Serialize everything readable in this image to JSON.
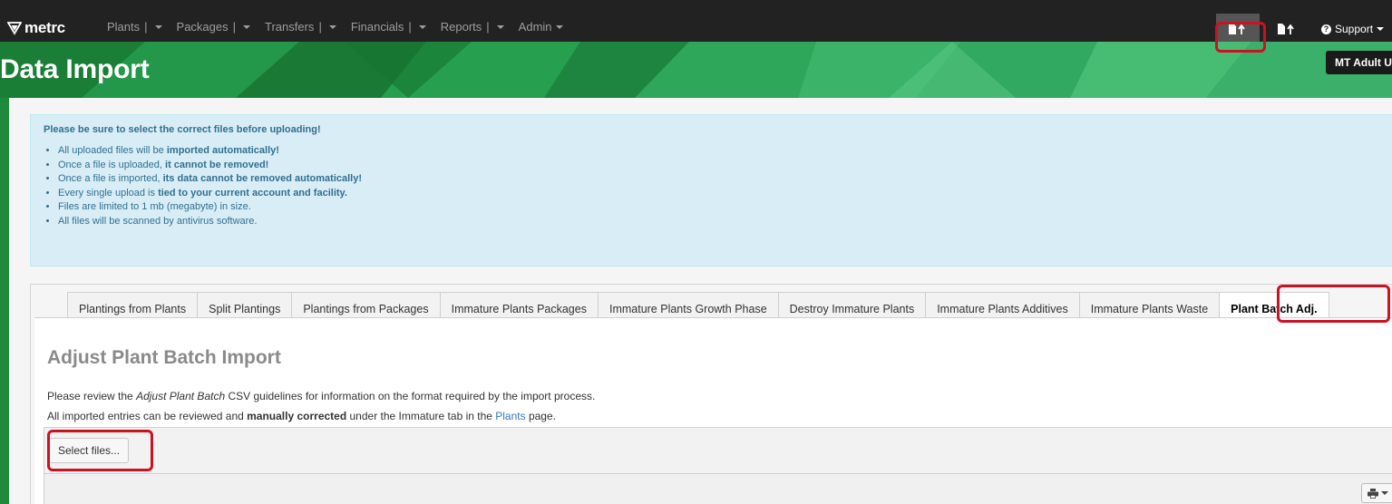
{
  "brand": {
    "name": "metrc"
  },
  "nav": {
    "items": [
      {
        "label": "Plants",
        "separator": "|"
      },
      {
        "label": "Packages",
        "separator": "|"
      },
      {
        "label": "Transfers",
        "separator": "|"
      },
      {
        "label": "Financials",
        "separator": "|"
      },
      {
        "label": "Reports",
        "separator": "|"
      },
      {
        "label": "Admin",
        "separator": ""
      }
    ],
    "support_label": "Support",
    "upload_icon": "file-upload-icon"
  },
  "header": {
    "title": "Data Import",
    "account_label": "MT Adult U"
  },
  "alert": {
    "lead": "Please be sure to select the correct files before uploading!",
    "items": [
      {
        "pre": "All uploaded files will be ",
        "bold": "imported automatically!",
        "post": ""
      },
      {
        "pre": "Once a file is uploaded, ",
        "bold": "it cannot be removed!",
        "post": ""
      },
      {
        "pre": "Once a file is imported, ",
        "bold": "its data cannot be removed automatically!",
        "post": ""
      },
      {
        "pre": "Every single upload is ",
        "bold": "tied to your current account and facility.",
        "post": ""
      },
      {
        "pre": "Files are limited to 1 mb (megabyte) in size.",
        "bold": "",
        "post": ""
      },
      {
        "pre": "All files will be scanned by antivirus software.",
        "bold": "",
        "post": ""
      }
    ]
  },
  "tabs": [
    {
      "label": "Plantings from Plants"
    },
    {
      "label": "Split Plantings"
    },
    {
      "label": "Plantings from Packages"
    },
    {
      "label": "Immature Plants Packages"
    },
    {
      "label": "Immature Plants Growth Phase"
    },
    {
      "label": "Destroy Immature Plants"
    },
    {
      "label": "Immature Plants Additives"
    },
    {
      "label": "Immature Plants Waste"
    },
    {
      "label": "Plant Batch Adj."
    }
  ],
  "active_tab": "Plant Batch Adj.",
  "section": {
    "title": "Adjust Plant Batch Import",
    "line1_pre": "Please review the ",
    "line1_italic": "Adjust Plant Batch",
    "line1_post": " CSV guidelines for information on the format required by the import process.",
    "line2_pre": "All imported entries can be reviewed and ",
    "line2_bold": "manually corrected",
    "line2_mid": " under the Immature tab in the ",
    "line2_link": "Plants",
    "line2_post": " page."
  },
  "upload": {
    "select_label": "Select files..."
  },
  "toolbar": {
    "print_icon": "print-icon"
  },
  "colors": {
    "nav_bg": "#222222",
    "green": "#1f8a3e",
    "alert_bg": "#d9edf7",
    "alert_text": "#31708f",
    "highlight": "#cc1122"
  }
}
